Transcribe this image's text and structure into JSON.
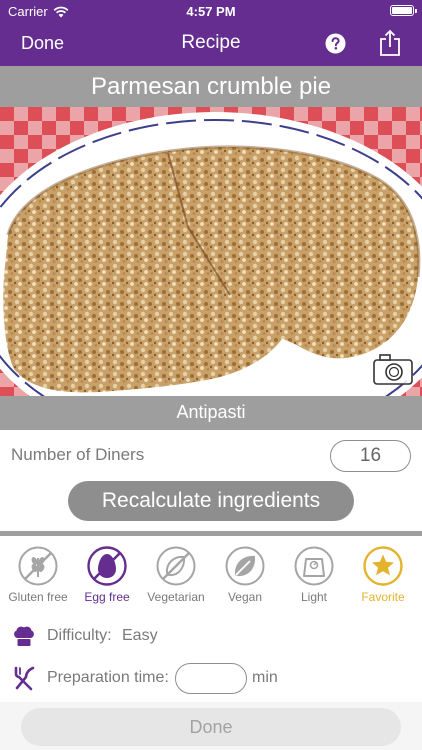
{
  "status_bar": {
    "carrier": "Carrier",
    "time": "4:57 PM"
  },
  "nav": {
    "done_label": "Done",
    "title": "Recipe",
    "help_icon": "question-circle-icon",
    "share_icon": "share-icon"
  },
  "recipe": {
    "title": "Parmesan crumble pie",
    "category": "Antipasti"
  },
  "diners": {
    "label": "Number of Diners",
    "value": "16"
  },
  "recalculate_label": "Recalculate ingredients",
  "tags": [
    {
      "label": "Gluten free",
      "icon": "wheat-icon",
      "state": "off"
    },
    {
      "label": "Egg free",
      "icon": "egg-icon",
      "state": "active"
    },
    {
      "label": "Vegetarian",
      "icon": "vegetarian-icon",
      "state": "off"
    },
    {
      "label": "Vegan",
      "icon": "leaf-icon",
      "state": "off"
    },
    {
      "label": "Light",
      "icon": "scale-icon",
      "state": "off"
    },
    {
      "label": "Favorite",
      "icon": "star-icon",
      "state": "favorite"
    }
  ],
  "details": {
    "difficulty_label": "Difficulty:",
    "difficulty_value": "Easy",
    "prep_label": "Preparation time:",
    "prep_value": "",
    "prep_unit": "min"
  },
  "bottom": {
    "done_label": "Done"
  },
  "colors": {
    "primary": "#652d90",
    "gray_bar": "#9e9e9e",
    "favorite": "#e3b32d"
  }
}
